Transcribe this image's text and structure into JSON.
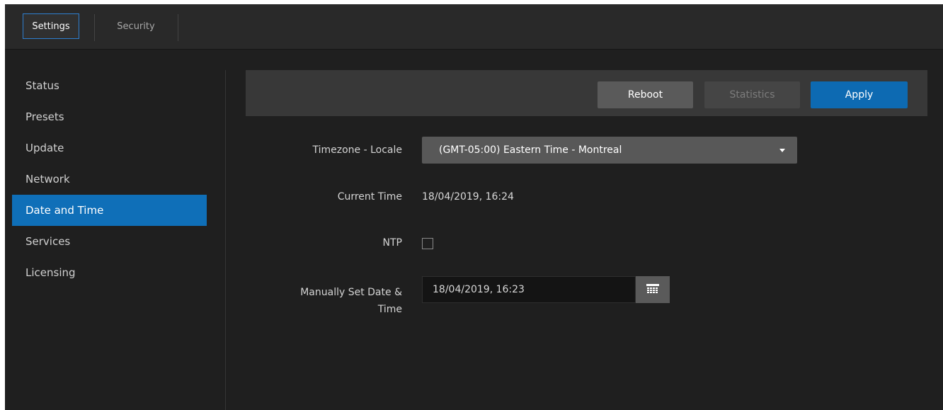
{
  "tabs": [
    {
      "label": "Settings",
      "active": true
    },
    {
      "label": "Security",
      "active": false
    }
  ],
  "sidebar": {
    "items": [
      {
        "label": "Status"
      },
      {
        "label": "Presets"
      },
      {
        "label": "Update"
      },
      {
        "label": "Network"
      },
      {
        "label": "Date and Time",
        "active": true
      },
      {
        "label": "Services"
      },
      {
        "label": "Licensing"
      }
    ]
  },
  "toolbar": {
    "reboot_label": "Reboot",
    "statistics_label": "Statistics",
    "apply_label": "Apply"
  },
  "form": {
    "timezone_label": "Timezone - Locale",
    "timezone_value": "(GMT-05:00) Eastern Time - Montreal",
    "current_time_label": "Current Time",
    "current_time_value": "18/04/2019, 16:24",
    "ntp_label": "NTP",
    "ntp_checked": false,
    "manual_label_line1": "Manually Set Date &",
    "manual_label_line2": "Time",
    "manual_value": "18/04/2019, 16:23"
  },
  "icons": {
    "dropdown": "chevron-down-icon",
    "calendar": "calendar-icon"
  },
  "colors": {
    "accent": "#0f6fb8",
    "apply": "#0d6ab2",
    "background": "#1f1f1f",
    "toolbar": "#383838"
  }
}
